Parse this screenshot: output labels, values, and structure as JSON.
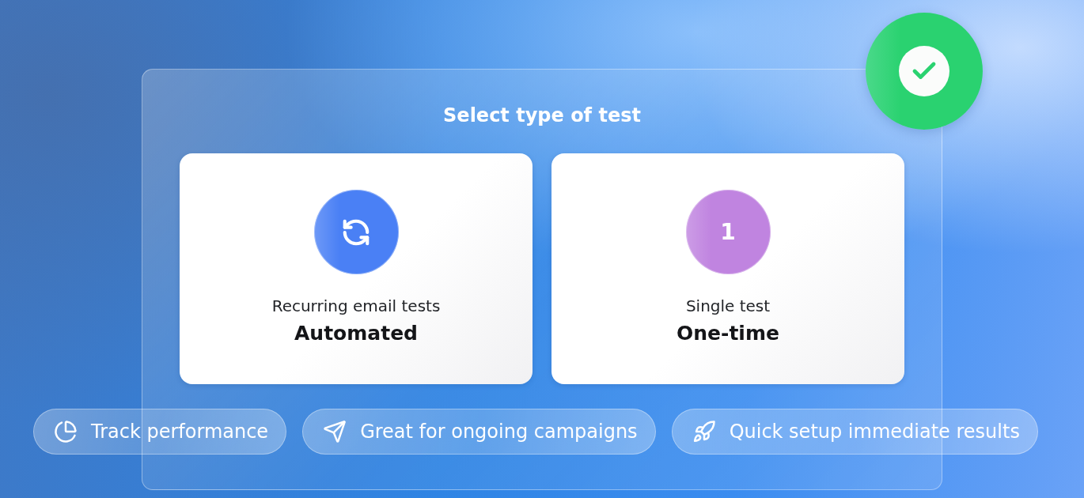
{
  "panel": {
    "title": "Select type of test"
  },
  "options": [
    {
      "kind": "icon",
      "subtitle": "Recurring email tests",
      "label": "Automated",
      "color": "#4a80f5"
    },
    {
      "kind": "number",
      "number": "1",
      "subtitle": "Single test",
      "label": "One-time",
      "color": "#c084e0"
    }
  ],
  "features": [
    {
      "kind": "chart",
      "label": "Track performance"
    },
    {
      "kind": "send",
      "label": "Great for ongoing campaigns"
    },
    {
      "kind": "rocket",
      "label": "Quick setup immediate results"
    }
  ]
}
